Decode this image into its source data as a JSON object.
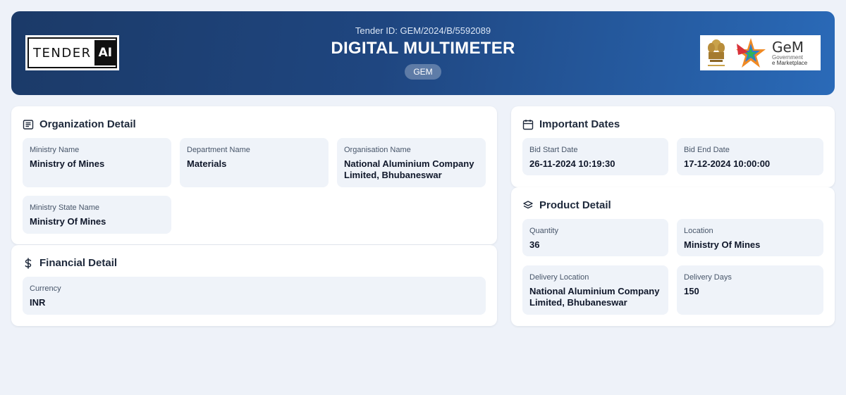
{
  "header": {
    "logo_left": {
      "word": "TENDER",
      "ai": "AI"
    },
    "tender_id": "Tender ID: GEM/2024/B/5592089",
    "title": "DIGITAL MULTIMETER",
    "badge": "GEM",
    "logo_right": {
      "name": "GeM",
      "line1": "Government",
      "line2": "e Marketplace"
    }
  },
  "organization": {
    "title": "Organization Detail",
    "icon": "list-icon",
    "fields": [
      {
        "label": "Ministry Name",
        "value": "Ministry of Mines"
      },
      {
        "label": "Department Name",
        "value": "Materials"
      },
      {
        "label": "Organisation Name",
        "value": "National Aluminium Company Limited, Bhubaneswar"
      },
      {
        "label": "Ministry State Name",
        "value": "Ministry Of Mines"
      }
    ]
  },
  "financial": {
    "title": "Financial Detail",
    "icon": "dollar-icon",
    "fields": [
      {
        "label": "Currency",
        "value": "INR"
      }
    ]
  },
  "dates": {
    "title": "Important Dates",
    "icon": "calendar-icon",
    "fields": [
      {
        "label": "Bid Start Date",
        "value": "26-11-2024 10:19:30"
      },
      {
        "label": "Bid End Date",
        "value": "17-12-2024 10:00:00"
      }
    ]
  },
  "product": {
    "title": "Product Detail",
    "icon": "layers-icon",
    "fields": [
      {
        "label": "Quantity",
        "value": "36"
      },
      {
        "label": "Location",
        "value": "Ministry Of Mines"
      },
      {
        "label": "Delivery Location",
        "value": "National Aluminium Company Limited, Bhubaneswar"
      },
      {
        "label": "Delivery Days",
        "value": "150"
      }
    ]
  }
}
